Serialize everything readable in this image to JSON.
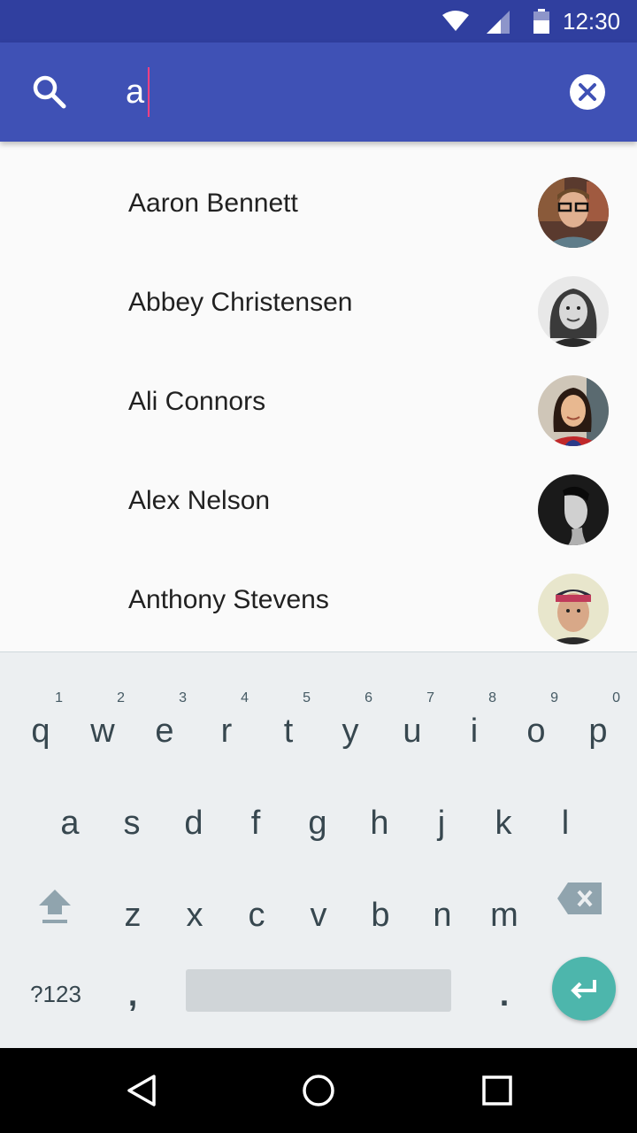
{
  "status_bar": {
    "time": "12:30",
    "icons": [
      "wifi-icon",
      "signal-icon",
      "battery-icon"
    ],
    "color": "#303f9f"
  },
  "search": {
    "query": "a",
    "icon": "search-icon",
    "clear_icon": "close-circle-icon",
    "toolbar_color": "#3f51b5",
    "caret_color": "#ff4081"
  },
  "results": [
    {
      "name": "Aaron Bennett",
      "avatar": "avatar-aaron"
    },
    {
      "name": "Abbey Christensen",
      "avatar": "avatar-abbey"
    },
    {
      "name": "Ali Connors",
      "avatar": "avatar-ali"
    },
    {
      "name": "Alex Nelson",
      "avatar": "avatar-alex"
    },
    {
      "name": "Anthony Stevens",
      "avatar": "avatar-anthony"
    }
  ],
  "keyboard": {
    "row1": [
      {
        "key": "q",
        "hint": "1"
      },
      {
        "key": "w",
        "hint": "2"
      },
      {
        "key": "e",
        "hint": "3"
      },
      {
        "key": "r",
        "hint": "4"
      },
      {
        "key": "t",
        "hint": "5"
      },
      {
        "key": "y",
        "hint": "6"
      },
      {
        "key": "u",
        "hint": "7"
      },
      {
        "key": "i",
        "hint": "8"
      },
      {
        "key": "o",
        "hint": "9"
      },
      {
        "key": "p",
        "hint": "0"
      }
    ],
    "row2": [
      "a",
      "s",
      "d",
      "f",
      "g",
      "h",
      "j",
      "k",
      "l"
    ],
    "row3": [
      "z",
      "x",
      "c",
      "v",
      "b",
      "n",
      "m"
    ],
    "symbols_label": "?123",
    "comma": ",",
    "period": ".",
    "enter_color": "#4db6ac"
  },
  "nav_bar": {
    "buttons": [
      "back-icon",
      "home-icon",
      "recents-icon"
    ]
  }
}
